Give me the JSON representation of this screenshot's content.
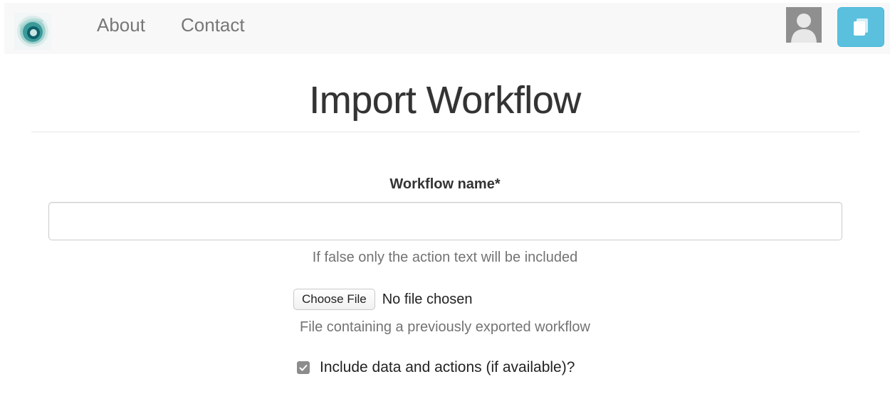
{
  "nav": {
    "brand_icon": "swirl-logo-icon",
    "links": [
      {
        "label": "About"
      },
      {
        "label": "Contact"
      }
    ],
    "avatar_icon": "user-avatar-icon",
    "action_icon": "document-icon",
    "action_color": "#5bc0de"
  },
  "page": {
    "title": "Import Workflow"
  },
  "form": {
    "name_label": "Workflow name*",
    "name_value": "",
    "name_help": "If false only the action text will be included",
    "file_button": "Choose File",
    "file_status": "No file chosen",
    "file_help": "File containing a previously exported workflow",
    "include_label": "Include data and actions (if available)?",
    "include_checked": true
  }
}
